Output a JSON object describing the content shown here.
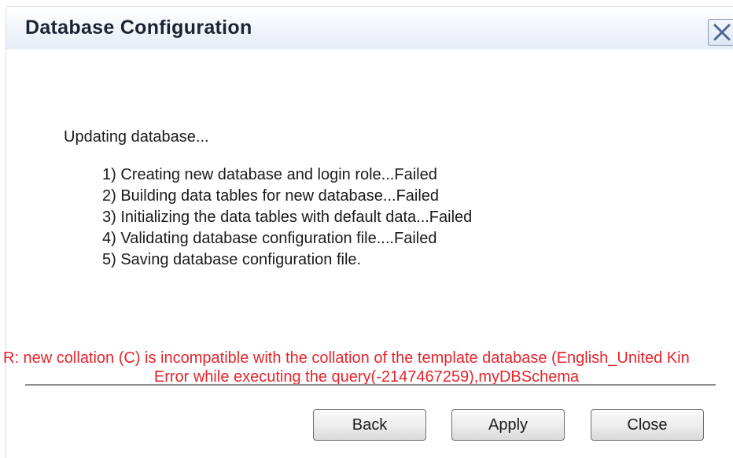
{
  "window": {
    "title": "Database Configuration",
    "close_icon": "close-icon"
  },
  "status": {
    "heading": "Updating database...",
    "steps": [
      "1) Creating new database and login role...Failed",
      "2) Building data tables for new database...Failed",
      "3) Initializing the data tables with default data...Failed",
      "4) Validating database configuration file....Failed",
      "5) Saving database configuration file."
    ]
  },
  "error": {
    "line1": "R: new collation (C) is incompatible with the collation of the template database (English_United Kin",
    "line2": "Error while executing the query(-2147467259),myDBSchema",
    "color": "#e8242b"
  },
  "buttons": {
    "back": "Back",
    "apply": "Apply",
    "close": "Close"
  }
}
